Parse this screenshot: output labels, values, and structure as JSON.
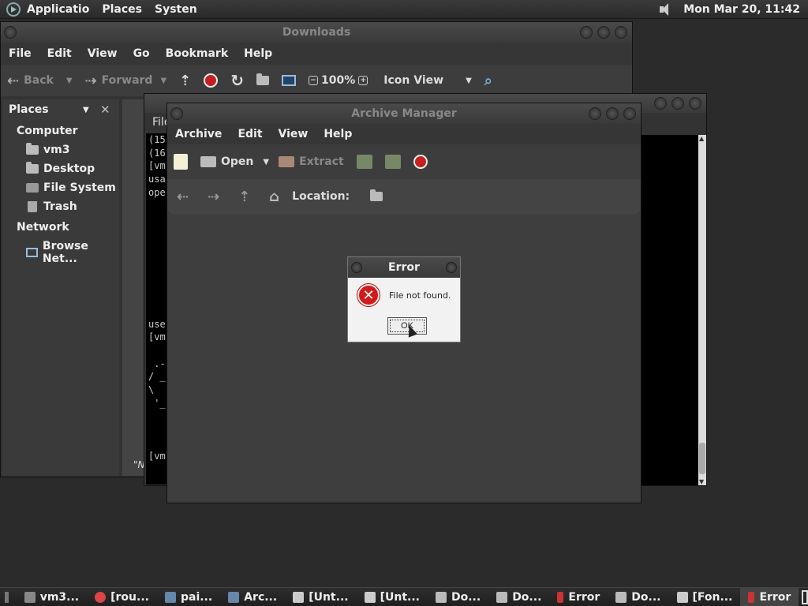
{
  "top_panel": {
    "menus": [
      "Applicatio",
      "Places",
      "Systen"
    ],
    "clock": "Mon Mar 20, 11:42"
  },
  "downloads": {
    "title": "Downloads",
    "menus": [
      "File",
      "Edit",
      "View",
      "Go",
      "Bookmark",
      "Help"
    ],
    "toolbar": {
      "back": "Back",
      "forward": "Forward",
      "zoom": "100%",
      "view_mode": "Icon View"
    },
    "places": {
      "header": "Places",
      "computer": "Computer",
      "items": [
        "vm3",
        "Desktop",
        "File System",
        "Trash"
      ],
      "network": "Network",
      "network_items": [
        "Browse Net..."
      ]
    },
    "status_fragment": "\"N"
  },
  "terminal": {
    "title_fragment": "File",
    "lines": [
      "(15",
      "(16",
      "[vm",
      "usa",
      "ope",
      "",
      "",
      "",
      "",
      "",
      "",
      "",
      "",
      "",
      "use",
      "[vm",
      "",
      " .-",
      "/ _",
      "\\",
      " '_",
      "",
      "",
      "",
      "[vm"
    ]
  },
  "archive": {
    "title": "Archive Manager",
    "menus": [
      "Archive",
      "Edit",
      "View",
      "Help"
    ],
    "toolbar": {
      "open": "Open",
      "extract": "Extract"
    },
    "location_label": "Location:"
  },
  "error": {
    "title": "Error",
    "message": "File not found.",
    "ok": "OK"
  },
  "taskbar": {
    "items": [
      "vm3...",
      "[rou...",
      "pai...",
      "Arc...",
      "[Unt...",
      "[Unt...",
      "Do...",
      "Do...",
      "Error",
      "Do...",
      "[Fon...",
      "Error"
    ]
  }
}
